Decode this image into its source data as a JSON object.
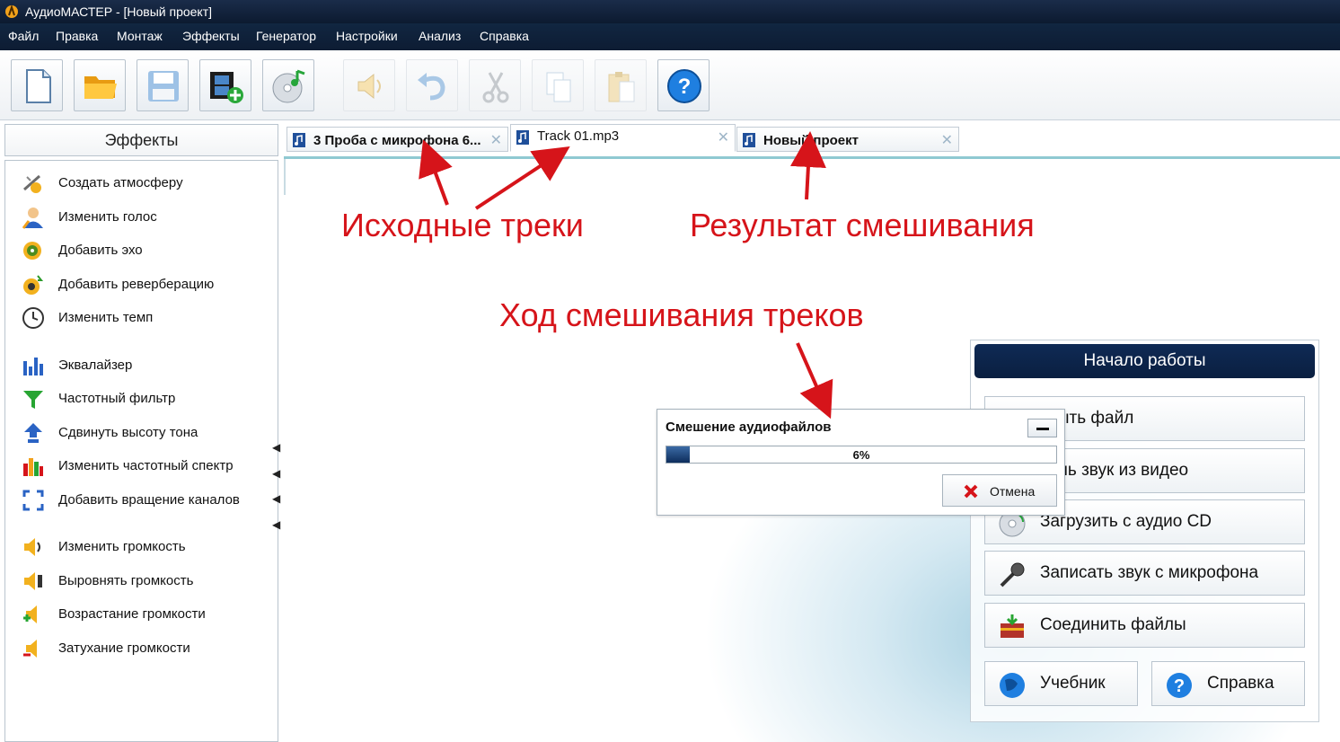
{
  "window": {
    "title": "АудиоМАСТЕР - [Новый проект]"
  },
  "menu": [
    "Файл",
    "Правка",
    "Монтаж",
    "Эффекты",
    "Генератор",
    "Настройки",
    "Анализ",
    "Справка"
  ],
  "toolbar": {
    "buttons": [
      {
        "name": "new-file",
        "icon": "new-document-icon",
        "enabled": true
      },
      {
        "name": "open",
        "icon": "folder-icon",
        "enabled": true
      },
      {
        "name": "save",
        "icon": "save-disk-icon",
        "enabled": true
      },
      {
        "name": "add-video",
        "icon": "film-add-icon",
        "enabled": true
      },
      {
        "name": "cd",
        "icon": "cd-music-icon",
        "enabled": true
      },
      {
        "name": "sound",
        "icon": "speaker-icon",
        "enabled": false
      },
      {
        "name": "undo",
        "icon": "undo-icon",
        "enabled": false
      },
      {
        "name": "cut",
        "icon": "scissors-icon",
        "enabled": false
      },
      {
        "name": "copy",
        "icon": "copy-icon",
        "enabled": false
      },
      {
        "name": "paste",
        "icon": "paste-icon",
        "enabled": false
      },
      {
        "name": "help",
        "icon": "help-icon",
        "enabled": true
      }
    ]
  },
  "effects": {
    "header": "Эффекты",
    "items": [
      {
        "label": "Создать атмосферу",
        "icon": "atmosphere-icon"
      },
      {
        "label": "Изменить голос",
        "icon": "voice-icon"
      },
      {
        "label": "Добавить эхо",
        "icon": "echo-icon"
      },
      {
        "label": "Добавить реверберацию",
        "icon": "reverb-icon"
      },
      {
        "label": "Изменить темп",
        "icon": "clock-icon"
      },
      {
        "label": "Эквалайзер",
        "icon": "equalizer-icon"
      },
      {
        "label": "Частотный фильтр",
        "icon": "funnel-icon"
      },
      {
        "label": "Сдвинуть высоту тона",
        "icon": "pitch-icon"
      },
      {
        "label": "Изменить частотный спектр",
        "icon": "spectrum-icon"
      },
      {
        "label": "Добавить вращение каналов",
        "icon": "rotate-icon"
      },
      {
        "label": "Изменить громкость",
        "icon": "volume-icon"
      },
      {
        "label": "Выровнять громкость",
        "icon": "normalize-icon"
      },
      {
        "label": "Возрастание громкости",
        "icon": "fade-in-icon"
      },
      {
        "label": "Затухание громкости",
        "icon": "fade-out-icon"
      }
    ]
  },
  "tabs": [
    {
      "label": "3 Проба с микрофона 6...",
      "close": "✕",
      "active": false
    },
    {
      "label": "Track 01.mp3",
      "close": "✕",
      "active": true
    },
    {
      "label": "Новый проект",
      "close": "✕",
      "active": false
    }
  ],
  "annotations": {
    "source_tracks": "Исходные треки",
    "mix_result": "Результат смешивания",
    "mix_progress": "Ход смешивания треков"
  },
  "start_panel": {
    "header": "Начало работы",
    "buttons": [
      {
        "label": "крыть файл",
        "icon": "folder-icon"
      },
      {
        "label": "лечь звук из видео",
        "icon": "film-icon"
      },
      {
        "label": "Загрузить с аудио CD",
        "icon": "cd-icon"
      },
      {
        "label": "Записать звук с микрофона",
        "icon": "microphone-icon"
      },
      {
        "label": "Соединить файлы",
        "icon": "join-files-icon"
      },
      {
        "label": "Учебник",
        "icon": "globe-icon"
      },
      {
        "label": "Справка",
        "icon": "help-icon"
      }
    ]
  },
  "dialog": {
    "title": "Смешение аудиофайлов",
    "progress_fraction": 0.06,
    "progress_text": "6%",
    "cancel_label": "Отмена"
  },
  "colors": {
    "titlebar": "#0c1a30",
    "accent_red": "#d6141a",
    "tab_underline": "#8fc9d2",
    "start_header": "#0f2a55"
  }
}
